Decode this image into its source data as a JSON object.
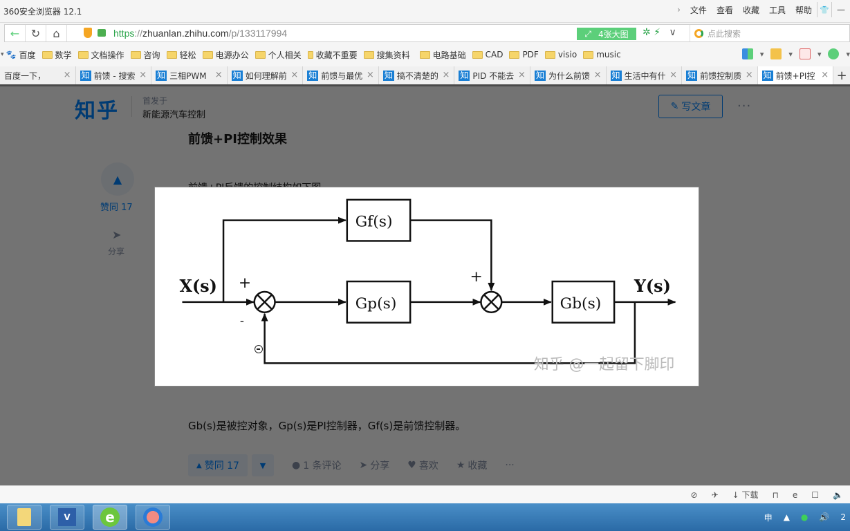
{
  "window": {
    "title": "360安全浏览器 12.1",
    "menus": [
      "文件",
      "查看",
      "收藏",
      "工具",
      "帮助"
    ],
    "expand_arrow": "›",
    "minimize": "—"
  },
  "addressbar": {
    "url_scheme": "https",
    "url_sep": "://",
    "url_host": "zhuanlan.zhihu.com",
    "url_path": "/p/133117994",
    "big_image_label": "4张大图",
    "search_placeholder": "点此搜索"
  },
  "bookmarks": [
    {
      "label": "百度",
      "icon": "baidu-paw-icon"
    },
    {
      "label": "数学",
      "icon": "folder-icon"
    },
    {
      "label": "文档操作",
      "icon": "folder-icon"
    },
    {
      "label": "咨询",
      "icon": "folder-icon"
    },
    {
      "label": "轻松",
      "icon": "folder-icon"
    },
    {
      "label": "电源办公",
      "icon": "folder-icon"
    },
    {
      "label": "个人相关",
      "icon": "folder-icon"
    },
    {
      "label": "收藏不重要",
      "icon": "folder-icon"
    },
    {
      "label": "搜集资料",
      "icon": "folder-icon"
    },
    {
      "label": "电路基础",
      "icon": "folder-icon"
    },
    {
      "label": "CAD",
      "icon": "folder-icon"
    },
    {
      "label": "PDF",
      "icon": "folder-icon"
    },
    {
      "label": "visio",
      "icon": "folder-icon"
    },
    {
      "label": "music",
      "icon": "folder-icon"
    }
  ],
  "tabs": [
    {
      "label": "百度一下，",
      "zh": false,
      "active": false
    },
    {
      "label": "前馈 - 搜索",
      "zh": true,
      "active": false
    },
    {
      "label": "三相PWM",
      "zh": true,
      "active": false
    },
    {
      "label": "如何理解前",
      "zh": true,
      "active": false
    },
    {
      "label": "前馈与最优",
      "zh": true,
      "active": false
    },
    {
      "label": "搞不清楚的",
      "zh": true,
      "active": false
    },
    {
      "label": "PID 不能去",
      "zh": true,
      "active": false
    },
    {
      "label": "为什么前馈",
      "zh": true,
      "active": false
    },
    {
      "label": "生活中有什",
      "zh": true,
      "active": false
    },
    {
      "label": "前馈控制质",
      "zh": true,
      "active": false
    },
    {
      "label": "前馈+PI控",
      "zh": true,
      "active": true
    }
  ],
  "tab_zh_badge": "知",
  "tab_close": "×",
  "tab_add": "+",
  "page": {
    "logo": "知乎",
    "published_label": "首发于",
    "column_name": "新能源汽车控制",
    "write_button": "写文章",
    "more": "···",
    "article_title": "前馈+PI控制效果",
    "intro": "前馈+PI反馈的控制结构如下图",
    "caption": "Gb(s)是被控对象，Gp(s)是PI控制器，Gf(s)是前馈控制器。",
    "side_vote_label": "赞同 17",
    "side_share_label": "分享",
    "actions": {
      "upvote": "赞同 17",
      "comments": "1 条评论",
      "share": "分享",
      "like": "喜欢",
      "collect": "收藏",
      "more": "···"
    }
  },
  "diagram": {
    "input_label": "X(s)",
    "output_label": "Y(s)",
    "gf_label": "Gf(s)",
    "gp_label": "Gp(s)",
    "gb_label": "Gb(s)",
    "plus": "+",
    "minus": "-",
    "watermark": "知乎 @一起留下脚印"
  },
  "statusbar": {
    "download": "下载"
  },
  "taskbar": {
    "ime": "申",
    "clock_partial": "2"
  }
}
